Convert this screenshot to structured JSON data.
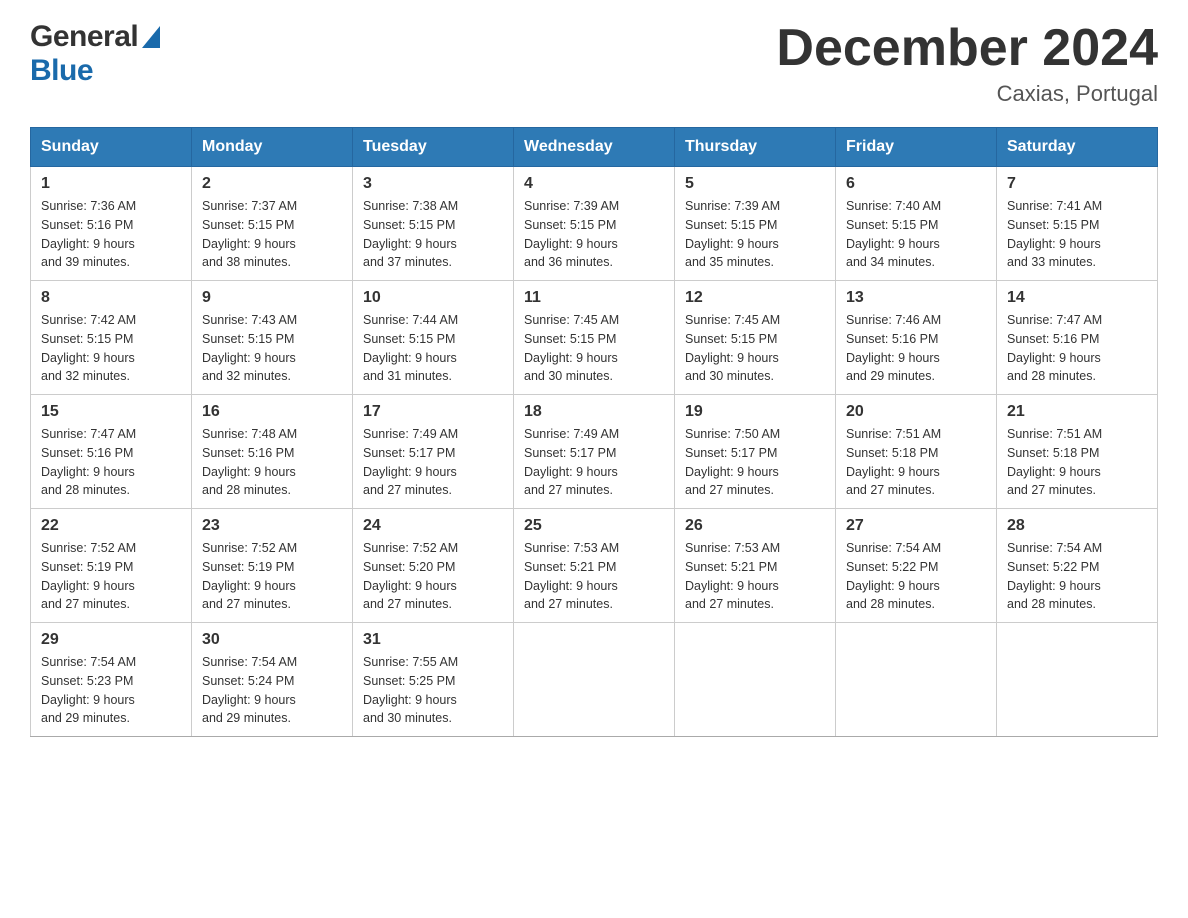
{
  "header": {
    "logo": {
      "general": "General",
      "blue": "Blue",
      "arrow_label": "logo-arrow"
    },
    "title": "December 2024",
    "location": "Caxias, Portugal"
  },
  "calendar": {
    "days_of_week": [
      "Sunday",
      "Monday",
      "Tuesday",
      "Wednesday",
      "Thursday",
      "Friday",
      "Saturday"
    ],
    "weeks": [
      [
        {
          "day": "1",
          "sunrise": "7:36 AM",
          "sunset": "5:16 PM",
          "daylight": "9 hours and 39 minutes."
        },
        {
          "day": "2",
          "sunrise": "7:37 AM",
          "sunset": "5:15 PM",
          "daylight": "9 hours and 38 minutes."
        },
        {
          "day": "3",
          "sunrise": "7:38 AM",
          "sunset": "5:15 PM",
          "daylight": "9 hours and 37 minutes."
        },
        {
          "day": "4",
          "sunrise": "7:39 AM",
          "sunset": "5:15 PM",
          "daylight": "9 hours and 36 minutes."
        },
        {
          "day": "5",
          "sunrise": "7:39 AM",
          "sunset": "5:15 PM",
          "daylight": "9 hours and 35 minutes."
        },
        {
          "day": "6",
          "sunrise": "7:40 AM",
          "sunset": "5:15 PM",
          "daylight": "9 hours and 34 minutes."
        },
        {
          "day": "7",
          "sunrise": "7:41 AM",
          "sunset": "5:15 PM",
          "daylight": "9 hours and 33 minutes."
        }
      ],
      [
        {
          "day": "8",
          "sunrise": "7:42 AM",
          "sunset": "5:15 PM",
          "daylight": "9 hours and 32 minutes."
        },
        {
          "day": "9",
          "sunrise": "7:43 AM",
          "sunset": "5:15 PM",
          "daylight": "9 hours and 32 minutes."
        },
        {
          "day": "10",
          "sunrise": "7:44 AM",
          "sunset": "5:15 PM",
          "daylight": "9 hours and 31 minutes."
        },
        {
          "day": "11",
          "sunrise": "7:45 AM",
          "sunset": "5:15 PM",
          "daylight": "9 hours and 30 minutes."
        },
        {
          "day": "12",
          "sunrise": "7:45 AM",
          "sunset": "5:15 PM",
          "daylight": "9 hours and 30 minutes."
        },
        {
          "day": "13",
          "sunrise": "7:46 AM",
          "sunset": "5:16 PM",
          "daylight": "9 hours and 29 minutes."
        },
        {
          "day": "14",
          "sunrise": "7:47 AM",
          "sunset": "5:16 PM",
          "daylight": "9 hours and 28 minutes."
        }
      ],
      [
        {
          "day": "15",
          "sunrise": "7:47 AM",
          "sunset": "5:16 PM",
          "daylight": "9 hours and 28 minutes."
        },
        {
          "day": "16",
          "sunrise": "7:48 AM",
          "sunset": "5:16 PM",
          "daylight": "9 hours and 28 minutes."
        },
        {
          "day": "17",
          "sunrise": "7:49 AM",
          "sunset": "5:17 PM",
          "daylight": "9 hours and 27 minutes."
        },
        {
          "day": "18",
          "sunrise": "7:49 AM",
          "sunset": "5:17 PM",
          "daylight": "9 hours and 27 minutes."
        },
        {
          "day": "19",
          "sunrise": "7:50 AM",
          "sunset": "5:17 PM",
          "daylight": "9 hours and 27 minutes."
        },
        {
          "day": "20",
          "sunrise": "7:51 AM",
          "sunset": "5:18 PM",
          "daylight": "9 hours and 27 minutes."
        },
        {
          "day": "21",
          "sunrise": "7:51 AM",
          "sunset": "5:18 PM",
          "daylight": "9 hours and 27 minutes."
        }
      ],
      [
        {
          "day": "22",
          "sunrise": "7:52 AM",
          "sunset": "5:19 PM",
          "daylight": "9 hours and 27 minutes."
        },
        {
          "day": "23",
          "sunrise": "7:52 AM",
          "sunset": "5:19 PM",
          "daylight": "9 hours and 27 minutes."
        },
        {
          "day": "24",
          "sunrise": "7:52 AM",
          "sunset": "5:20 PM",
          "daylight": "9 hours and 27 minutes."
        },
        {
          "day": "25",
          "sunrise": "7:53 AM",
          "sunset": "5:21 PM",
          "daylight": "9 hours and 27 minutes."
        },
        {
          "day": "26",
          "sunrise": "7:53 AM",
          "sunset": "5:21 PM",
          "daylight": "9 hours and 27 minutes."
        },
        {
          "day": "27",
          "sunrise": "7:54 AM",
          "sunset": "5:22 PM",
          "daylight": "9 hours and 28 minutes."
        },
        {
          "day": "28",
          "sunrise": "7:54 AM",
          "sunset": "5:22 PM",
          "daylight": "9 hours and 28 minutes."
        }
      ],
      [
        {
          "day": "29",
          "sunrise": "7:54 AM",
          "sunset": "5:23 PM",
          "daylight": "9 hours and 29 minutes."
        },
        {
          "day": "30",
          "sunrise": "7:54 AM",
          "sunset": "5:24 PM",
          "daylight": "9 hours and 29 minutes."
        },
        {
          "day": "31",
          "sunrise": "7:55 AM",
          "sunset": "5:25 PM",
          "daylight": "9 hours and 30 minutes."
        },
        null,
        null,
        null,
        null
      ]
    ],
    "labels": {
      "sunrise": "Sunrise:",
      "sunset": "Sunset:",
      "daylight": "Daylight:"
    }
  }
}
